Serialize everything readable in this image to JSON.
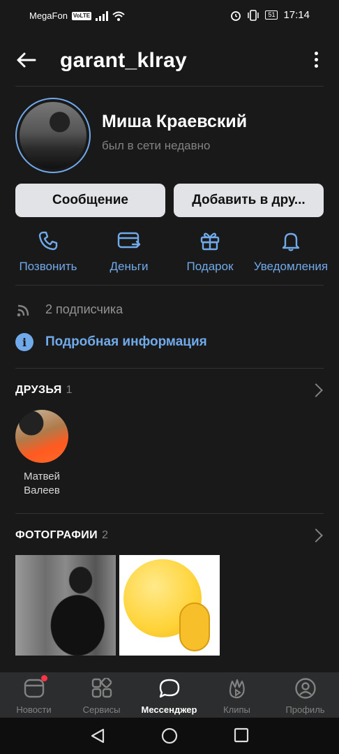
{
  "status_bar": {
    "carrier": "MegaFon",
    "network_badge": "VoLTE",
    "battery": "51",
    "time": "17:14"
  },
  "header": {
    "title": "garant_klray"
  },
  "profile": {
    "name": "Миша Краевский",
    "last_seen": "был в сети недавно"
  },
  "buttons": {
    "message": "Сообщение",
    "add_friend": "Добавить в дру..."
  },
  "actions": [
    {
      "label": "Позвонить",
      "icon": "phone-icon"
    },
    {
      "label": "Деньги",
      "icon": "money-icon"
    },
    {
      "label": "Подарок",
      "icon": "gift-icon"
    },
    {
      "label": "Уведомления",
      "icon": "bell-icon"
    }
  ],
  "info": {
    "followers": "2 подписчика",
    "details": "Подробная информация"
  },
  "friends": {
    "title": "ДРУЗЬЯ",
    "count": "1",
    "items": [
      {
        "name": "Матвей Валеев"
      }
    ]
  },
  "photos": {
    "title": "ФОТОГРАФИИ",
    "count": "2"
  },
  "tabs": [
    {
      "label": "Новости",
      "icon": "news-icon"
    },
    {
      "label": "Сервисы",
      "icon": "services-icon"
    },
    {
      "label": "Мессенджер",
      "icon": "messenger-icon",
      "active": true
    },
    {
      "label": "Клипы",
      "icon": "clips-icon"
    },
    {
      "label": "Профиль",
      "icon": "profile-icon"
    }
  ],
  "colors": {
    "accent": "#71aaeb",
    "background": "#191919",
    "button": "#e1e3e6",
    "tabbar": "#2c2d2e",
    "badge": "#ff3347"
  }
}
